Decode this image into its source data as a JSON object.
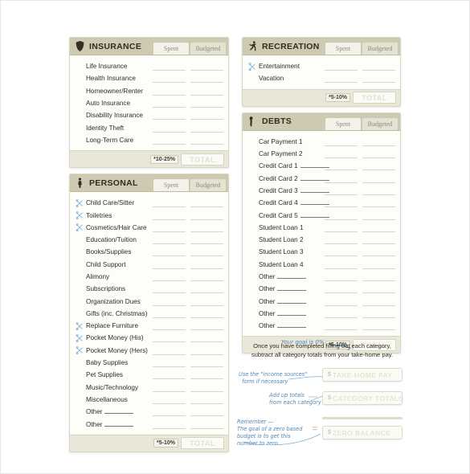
{
  "tabs": {
    "spent": "Spent",
    "budgeted": "Budgeted"
  },
  "total_label": "TOTAL",
  "sections": [
    {
      "id": "insurance",
      "title": "INSURANCE",
      "icon": "shield-icon",
      "percent": "*10-25%",
      "items": [
        {
          "label": "Life Insurance",
          "icon": false,
          "blank": false
        },
        {
          "label": "Health Insurance",
          "icon": false,
          "blank": false
        },
        {
          "label": "Homeowner/Renter",
          "icon": false,
          "blank": false
        },
        {
          "label": "Auto Insurance",
          "icon": false,
          "blank": false
        },
        {
          "label": "Disability Insurance",
          "icon": false,
          "blank": false
        },
        {
          "label": "Identity Theft",
          "icon": false,
          "blank": false
        },
        {
          "label": "Long-Term Care",
          "icon": false,
          "blank": false
        }
      ]
    },
    {
      "id": "personal",
      "title": "PERSONAL",
      "icon": "person-icon",
      "percent": "*5-10%",
      "items": [
        {
          "label": "Child Care/Sitter",
          "icon": true,
          "blank": false
        },
        {
          "label": "Toiletries",
          "icon": true,
          "blank": false
        },
        {
          "label": "Cosmetics/Hair Care",
          "icon": true,
          "blank": false
        },
        {
          "label": "Education/Tuition",
          "icon": false,
          "blank": false
        },
        {
          "label": "Books/Supplies",
          "icon": false,
          "blank": false
        },
        {
          "label": "Child Support",
          "icon": false,
          "blank": false
        },
        {
          "label": "Alimony",
          "icon": false,
          "blank": false
        },
        {
          "label": "Subscriptions",
          "icon": false,
          "blank": false
        },
        {
          "label": "Organization Dues",
          "icon": false,
          "blank": false
        },
        {
          "label": "Gifts (inc. Christmas)",
          "icon": false,
          "blank": false
        },
        {
          "label": "Replace Furniture",
          "icon": true,
          "blank": false
        },
        {
          "label": "Pocket Money (His)",
          "icon": true,
          "blank": false
        },
        {
          "label": "Pocket Money (Hers)",
          "icon": true,
          "blank": false
        },
        {
          "label": "Baby Supplies",
          "icon": false,
          "blank": false
        },
        {
          "label": "Pet Supplies",
          "icon": false,
          "blank": false
        },
        {
          "label": "Music/Technology",
          "icon": false,
          "blank": false
        },
        {
          "label": "Miscellaneous",
          "icon": false,
          "blank": false
        },
        {
          "label": "Other",
          "icon": false,
          "blank": true
        },
        {
          "label": "Other",
          "icon": false,
          "blank": true
        }
      ]
    },
    {
      "id": "recreation",
      "title": "RECREATION",
      "icon": "runner-icon",
      "percent": "*5-10%",
      "items": [
        {
          "label": "Entertainment",
          "icon": true,
          "blank": false
        },
        {
          "label": "Vacation",
          "icon": false,
          "blank": false
        }
      ]
    },
    {
      "id": "debts",
      "title": "DEBTS",
      "icon": "debt-icon",
      "percent": "*5-10%",
      "goal_note": "Your goal is 0%",
      "items": [
        {
          "label": "Car Payment 1",
          "icon": false,
          "blank": false
        },
        {
          "label": "Car Payment 2",
          "icon": false,
          "blank": false
        },
        {
          "label": "Credit Card 1",
          "icon": false,
          "blank": true
        },
        {
          "label": "Credit Card 2",
          "icon": false,
          "blank": true
        },
        {
          "label": "Credit Card 3",
          "icon": false,
          "blank": true
        },
        {
          "label": "Credit Card 4",
          "icon": false,
          "blank": true
        },
        {
          "label": "Credit Card 5",
          "icon": false,
          "blank": true
        },
        {
          "label": "Student Loan 1",
          "icon": false,
          "blank": false
        },
        {
          "label": "Student Loan 2",
          "icon": false,
          "blank": false
        },
        {
          "label": "Student Loan 3",
          "icon": false,
          "blank": false
        },
        {
          "label": "Student Loan 4",
          "icon": false,
          "blank": false
        },
        {
          "label": "Other",
          "icon": false,
          "blank": true
        },
        {
          "label": "Other",
          "icon": false,
          "blank": true
        },
        {
          "label": "Other",
          "icon": false,
          "blank": true
        },
        {
          "label": "Other",
          "icon": false,
          "blank": true
        },
        {
          "label": "Other",
          "icon": false,
          "blank": true
        }
      ]
    }
  ],
  "summary": {
    "line1": "Once you have completed filling out each category,",
    "line2": "subtract all category totals from your take-home pay.",
    "buttons": [
      {
        "id": "takehome",
        "label": "TAKE-HOME PAY",
        "symbol": "$"
      },
      {
        "id": "categories",
        "label": "CATEGORY TOTALS",
        "symbol": "$"
      },
      {
        "id": "zero",
        "label": "ZERO BALANCE",
        "symbol": "$"
      }
    ],
    "operators": {
      "minus": "—",
      "equals": "="
    },
    "annotations": [
      "Use the \"income sources\"\n  form if necessary",
      "Add up totals\nfrom each category",
      "Remember —\nThe goal of a zero based\nbudget is to get this\nnumber to zero"
    ]
  },
  "colors": {
    "header_bg": "#cdcab1",
    "card_bg": "#fdfdf9",
    "footer_bg": "#e8e7d8",
    "ink": "#2f2d24",
    "hand_blue": "#4f87b8",
    "field_line": "#d9d6c6"
  }
}
